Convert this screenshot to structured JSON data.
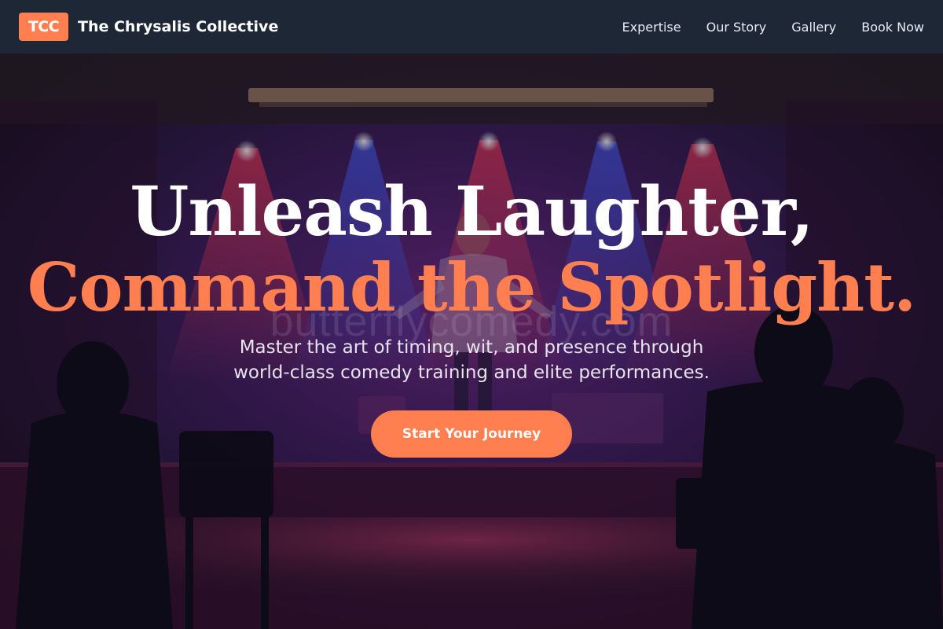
{
  "header": {
    "logo_text": "TCC",
    "brand_name": "The Chrysalis Collective",
    "nav": [
      "Expertise",
      "Our Story",
      "Gallery",
      "Book Now"
    ]
  },
  "hero": {
    "headline_line1": "Unleash Laughter,",
    "headline_line2": "Command the Spotlight.",
    "subtitle_line1": "Master the art of timing, wit, and presence through",
    "subtitle_line2": "world-class comedy training and elite performances.",
    "cta_label": "Start Your Journey",
    "image_watermark": "butterflycomedy.com"
  },
  "colors": {
    "accent": "#ff7f50",
    "header_bg": "#1e2736",
    "headline_white": "#ffffff"
  }
}
